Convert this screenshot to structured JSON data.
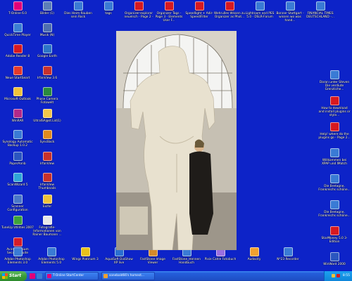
{
  "desktop": {
    "left_col1": [
      {
        "label": "T-Online 6.0",
        "icon": "t-online-icon",
        "color": "#e2007a"
      },
      {
        "label": "QuickTime Player",
        "icon": "quicktime-icon",
        "color": "#3b7fd4"
      },
      {
        "label": "Adobe Reader 8",
        "icon": "adobe-reader-icon",
        "color": "#d71920"
      },
      {
        "label": "Neue StartSeart",
        "icon": "startseite-icon",
        "color": "#e43a2a"
      },
      {
        "label": "Microsoft Outlook",
        "icon": "outlook-icon",
        "color": "#f0c23a"
      },
      {
        "label": "WinRAR",
        "icon": "winrar-icon",
        "color": "#b2298a"
      },
      {
        "label": "Synology Automatic Backup 1.0.2",
        "icon": "backup-icon",
        "color": "#3a7bd5"
      },
      {
        "label": "PaperAnnb",
        "icon": "paper-icon",
        "color": "#2b56c0"
      },
      {
        "label": "ScanWizard 5",
        "icon": "scanwizard-icon",
        "color": "#2fa6d8"
      },
      {
        "label": "Scanner Configuration",
        "icon": "scanner-icon",
        "color": "#4a78c9"
      },
      {
        "label": "TuneUp Utilities 2007",
        "icon": "tuneup-icon",
        "color": "#3fa33a"
      },
      {
        "label": "Avira Premium Security Suite",
        "icon": "avira-icon",
        "color": "#d51d29"
      }
    ],
    "left_col2": [
      {
        "label": "Bilder (1)",
        "icon": "folder-pictures-icon",
        "color": "#5c7fb8"
      },
      {
        "label": "Musik (N)",
        "icon": "folder-music-icon",
        "color": "#4e6fb0"
      },
      {
        "label": "Google Earth",
        "icon": "google-earth-icon",
        "color": "#2d75c8"
      },
      {
        "label": "IrfanView 3.6",
        "icon": "irfanview-icon",
        "color": "#c8312c"
      },
      {
        "label": "Phase Camera Fotowelt",
        "icon": "fotowelt-icon",
        "color": "#2a8a3f"
      },
      {
        "label": "UltraISA@st.Lid(1)",
        "icon": "folder-icon",
        "color": "#f2c54a"
      },
      {
        "label": "SyncBack",
        "icon": "syncback-icon",
        "color": "#e08a1e"
      },
      {
        "label": "IrfanView",
        "icon": "irfanview2-icon",
        "color": "#c8312c"
      },
      {
        "label": "IrfanView Thumbnails",
        "icon": "thumbnails-icon",
        "color": "#c8312c"
      },
      {
        "label": "Exifer",
        "icon": "exifer-icon",
        "color": "#f0c23a"
      },
      {
        "label": "Fotografie-Informationen von Rainer Baumann ...",
        "icon": "document-icon",
        "color": "#e8e8e8"
      }
    ],
    "top_row": [
      {
        "label": "Dies Heim Rauben sein Rock",
        "icon": "shortcut-icon",
        "color": "#3a7bd5"
      },
      {
        "label": "tags",
        "icon": "tags-icon",
        "color": "#3a7bd5"
      },
      {
        "label": "Organizer-explorer neuelsch - Page 2 -",
        "icon": "pdf-icon",
        "color": "#d71920"
      },
      {
        "label": "Organizer Tags - Page 3 - Elements User F...",
        "icon": "pdf-icon",
        "color": "#d71920"
      },
      {
        "label": "Speedlight + Adir-Speed/Filter",
        "icon": "pdf-icon",
        "color": "#d71920"
      },
      {
        "label": "Wehrulles Wissen zu Organizer as Phot...",
        "icon": "pdf-icon",
        "color": "#d71920"
      },
      {
        "label": "Lightroom and PES 5.0 - DSLR-Forum",
        "icon": "web-icon",
        "color": "#3a7bd5"
      },
      {
        "label": "Bonner Stuttgart - wissen wo was hand...",
        "icon": "web-icon",
        "color": "#3a7bd5"
      },
      {
        "label": "FINANCIAL TIMES DEUTSCHLAND -...",
        "icon": "web-icon",
        "color": "#3a7bd5"
      }
    ],
    "right_col": [
      {
        "label": "Daran unter Steven Die verdiute Grenzliche...",
        "icon": "web-icon",
        "color": "#3a7bd5"
      },
      {
        "label": "How to download and install plugins or style...",
        "icon": "pdf-icon",
        "color": "#d71920"
      },
      {
        "label": "Help! where do the plugins go - Page 2...",
        "icon": "pdf-icon",
        "color": "#d71920"
      },
      {
        "label": "Willkommen bei XPAP und IMatch",
        "icon": "web-icon",
        "color": "#3a7bd5"
      },
      {
        "label": "Die Bretagne, Frankreichs schöne...",
        "icon": "web-icon",
        "color": "#3a7bd5"
      },
      {
        "label": "Die Bretagne, Frankreichs schöne...",
        "icon": "web-icon",
        "color": "#3a7bd5"
      },
      {
        "label": "StarMoney 5.0 3-Edition",
        "icon": "starmoney-icon",
        "color": "#d71920"
      },
      {
        "label": "WinWord 2000",
        "icon": "winword-icon",
        "color": "#2b56c0"
      }
    ],
    "bottom_row": [
      {
        "label": "Adobe Photoshop Elements 3.0",
        "icon": "photoshop-elements-icon",
        "color": "#3a7bd5"
      },
      {
        "label": "Adobe Photoshop Elements 5.0",
        "icon": "photoshop-elements5-icon",
        "color": "#3a7bd5"
      },
      {
        "label": "Wings Platinum 3",
        "icon": "wings-icon",
        "color": "#e8c21a"
      },
      {
        "label": "AquaSoft DiaShow XP live",
        "icon": "diashow-icon",
        "color": "#2a6fd1"
      },
      {
        "label": "FastStone Image Viewer",
        "icon": "faststone-icon",
        "color": "#d58a2a"
      },
      {
        "label": "FastStone_Hennen Handbuch",
        "icon": "faststone-manual-icon",
        "color": "#3a7bd5"
      },
      {
        "label": "Pixie Cahle Fotobuch",
        "icon": "fotobuch-icon",
        "color": "#9a6fe0"
      },
      {
        "label": "Audacity",
        "icon": "audacity-icon",
        "color": "#f0a030"
      },
      {
        "label": "N*23 Recorder",
        "icon": "recorder-icon",
        "color": "#3a7bd5"
      }
    ]
  },
  "taskbar": {
    "start_label": "Start",
    "tasks": [
      {
        "label": "T-Online StartCenter",
        "icon": "t-online-task-icon",
        "color": "#e2007a"
      },
      {
        "label": "sonebald66's homest...",
        "icon": "browser-task-icon",
        "color": "#f0a030"
      }
    ],
    "clock": "8:55"
  },
  "colors": {
    "desktop_bg": "#0d23c8",
    "taskbar": "#245edb",
    "start_button": "#3a9d3a"
  }
}
